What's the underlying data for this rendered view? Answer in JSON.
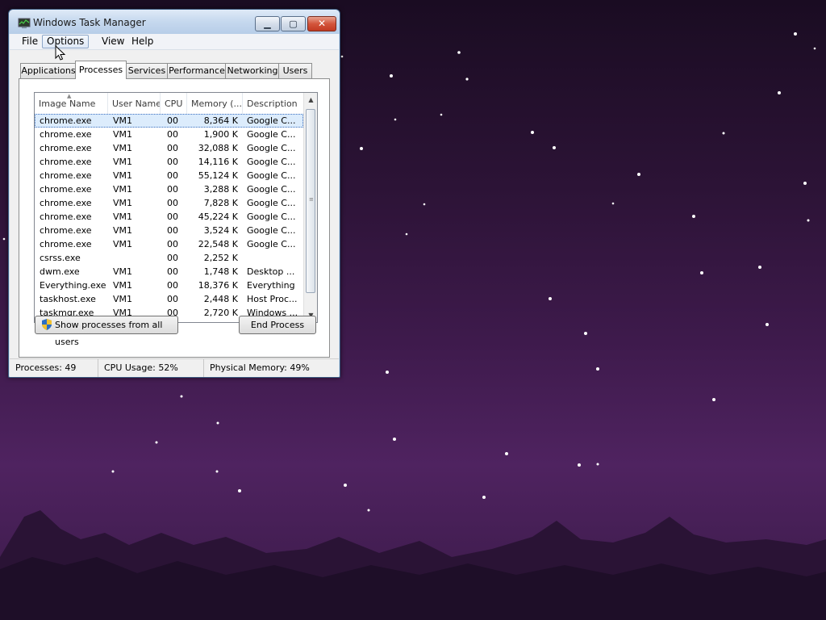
{
  "window": {
    "title": "Windows Task Manager",
    "controls": {
      "minimize": "▁",
      "maximize": "▢",
      "close": "✕"
    }
  },
  "menu": [
    "File",
    "Options",
    "View",
    "Help"
  ],
  "tabs": [
    "Applications",
    "Processes",
    "Services",
    "Performance",
    "Networking",
    "Users"
  ],
  "active_tab": "Processes",
  "columns": [
    "Image Name",
    "User Name",
    "CPU",
    "Memory (...",
    "Description"
  ],
  "processes": [
    {
      "name": "chrome.exe",
      "user": "VM1",
      "cpu": "00",
      "mem": "8,364 K",
      "desc": "Google C..."
    },
    {
      "name": "chrome.exe",
      "user": "VM1",
      "cpu": "00",
      "mem": "1,900 K",
      "desc": "Google C..."
    },
    {
      "name": "chrome.exe",
      "user": "VM1",
      "cpu": "00",
      "mem": "32,088 K",
      "desc": "Google C..."
    },
    {
      "name": "chrome.exe",
      "user": "VM1",
      "cpu": "00",
      "mem": "14,116 K",
      "desc": "Google C..."
    },
    {
      "name": "chrome.exe",
      "user": "VM1",
      "cpu": "00",
      "mem": "55,124 K",
      "desc": "Google C..."
    },
    {
      "name": "chrome.exe",
      "user": "VM1",
      "cpu": "00",
      "mem": "3,288 K",
      "desc": "Google C..."
    },
    {
      "name": "chrome.exe",
      "user": "VM1",
      "cpu": "00",
      "mem": "7,828 K",
      "desc": "Google C..."
    },
    {
      "name": "chrome.exe",
      "user": "VM1",
      "cpu": "00",
      "mem": "45,224 K",
      "desc": "Google C..."
    },
    {
      "name": "chrome.exe",
      "user": "VM1",
      "cpu": "00",
      "mem": "3,524 K",
      "desc": "Google C..."
    },
    {
      "name": "chrome.exe",
      "user": "VM1",
      "cpu": "00",
      "mem": "22,548 K",
      "desc": "Google C..."
    },
    {
      "name": "csrss.exe",
      "user": "",
      "cpu": "00",
      "mem": "2,252 K",
      "desc": ""
    },
    {
      "name": "dwm.exe",
      "user": "VM1",
      "cpu": "00",
      "mem": "1,748 K",
      "desc": "Desktop ..."
    },
    {
      "name": "Everything.exe",
      "user": "VM1",
      "cpu": "00",
      "mem": "18,376 K",
      "desc": "Everything"
    },
    {
      "name": "taskhost.exe",
      "user": "VM1",
      "cpu": "00",
      "mem": "2,448 K",
      "desc": "Host Proc..."
    },
    {
      "name": "taskmgr.exe",
      "user": "VM1",
      "cpu": "00",
      "mem": "2,720 K",
      "desc": "Windows ..."
    }
  ],
  "buttons": {
    "show_all": "Show processes from all users",
    "end_process": "End Process"
  },
  "status": {
    "processes": "Processes: 49",
    "cpu": "CPU Usage: 52%",
    "memory": "Physical Memory: 49%"
  },
  "icons": {
    "app": "task-manager-icon",
    "shield": "uac-shield-icon",
    "cursor": "mouse-pointer-icon"
  },
  "colors": {
    "selection": "#dcecfc",
    "title_bar": "#c5d8ee",
    "desktop": "#3e1a4c"
  }
}
